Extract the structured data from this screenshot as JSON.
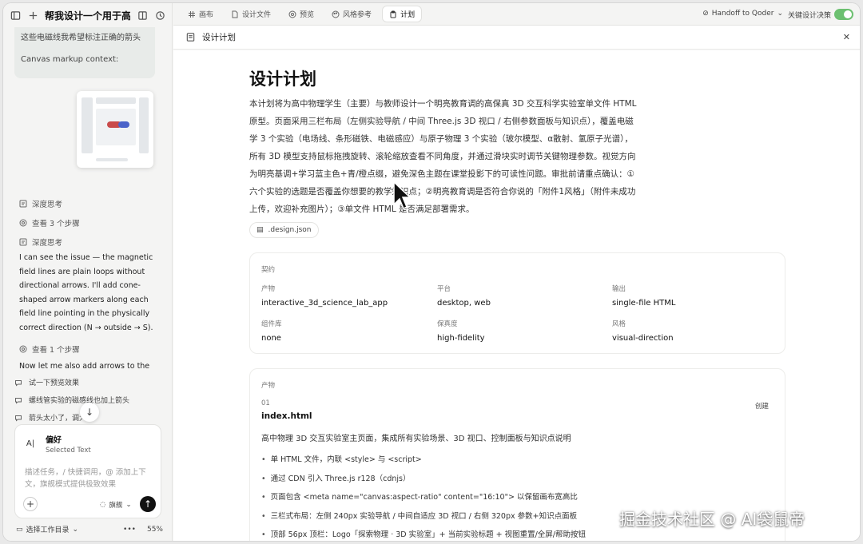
{
  "conversation": {
    "title": "帮我设计一个用于高中...",
    "context_card": {
      "line1": "这些电磁线我希望标注正确的箭头",
      "line2": "Canvas markup context:"
    }
  },
  "steps": [
    {
      "label": "深度思考"
    },
    {
      "label": "查看 3 个步骤"
    },
    {
      "label": "深度思考"
    },
    {
      "label": "查看 1 个步骤"
    }
  ],
  "messages": {
    "main": "I can see the issue — the magnetic field lines are plain loops without directional arrows. I'll add cone-shaped arrow markers along each field line pointing in the physically correct direction (N → outside → S).",
    "followup": "Now let me also add arrows to the"
  },
  "suggestions": [
    {
      "label": "试一下预览效果"
    },
    {
      "label": "螺线管实验的磁感线也加上箭头"
    },
    {
      "label": "箭头太小了，调大"
    }
  ],
  "composer": {
    "pref_title": "偏好",
    "pref_subtitle": "Selected Text",
    "placeholder": "描述任务，/ 快捷调用，@ 添加上下文，旗舰模式提供极致效果",
    "mode": "旗舰"
  },
  "footer": {
    "workspace": "选择工作目录",
    "dots": "•••",
    "percent": "55%"
  },
  "tabs": [
    {
      "label": "画布",
      "icon": "hash-icon"
    },
    {
      "label": "设计文件",
      "icon": "file-icon"
    },
    {
      "label": "预览",
      "icon": "eye-icon"
    },
    {
      "label": "风格参考",
      "icon": "palette-icon"
    },
    {
      "label": "计划",
      "icon": "clipboard-icon",
      "active": true
    }
  ],
  "topbar": {
    "handoff": "Handoff to Qoder",
    "toggle_label": "关键设计决策",
    "toggle_on": true
  },
  "doc": {
    "header_title": "设计计划",
    "title": "设计计划",
    "summary": "本计划将为高中物理学生（主要）与教师设计一个明亮教育调的高保真 3D 交互科学实验室单文件 HTML 原型。页面采用三栏布局（左侧实验导航 / 中间 Three.js 3D 视口 / 右侧参数面板与知识点），覆盖电磁学 3 个实验（电场线、条形磁铁、电磁感应）与原子物理 3 个实验（玻尔模型、α散射、氢原子光谱），所有 3D 模型支持鼠标拖拽旋转、滚轮缩放查看不同角度，并通过滑块实时调节关键物理参数。视觉方向为明亮基调+学习蓝主色+青/橙点缀，避免深色主题在课堂投影下的可读性问题。审批前请重点确认：①六个实验的选题是否覆盖你想要的教学知识点；②明亮教育调是否符合你说的「附件1风格」（附件未成功上传，欢迎补充图片）；③单文件 HTML 是否满足部署需求。",
    "file_chip": ".design.json"
  },
  "contract": {
    "label": "契约",
    "fields": [
      {
        "key": "产物",
        "value": "interactive_3d_science_lab_app"
      },
      {
        "key": "平台",
        "value": "desktop, web"
      },
      {
        "key": "输出",
        "value": "single-file HTML"
      },
      {
        "key": "组件库",
        "value": "none"
      },
      {
        "key": "保真度",
        "value": "high-fidelity"
      },
      {
        "key": "风格",
        "value": "visual-direction"
      }
    ]
  },
  "artifacts": {
    "label": "产物",
    "number": "01",
    "file": "index.html",
    "action": "创建",
    "description": "高中物理 3D 交互实验室主页面，集成所有实验场景、3D 视口、控制面板与知识点说明",
    "bullets": [
      "单 HTML 文件，内联 <style> 与 <script>",
      "通过 CDN 引入 Three.js r128（cdnjs）",
      "页面包含 <meta name=\"canvas:aspect-ratio\" content=\"16:10\"> 以保留画布宽高比",
      "三栏式布局：左侧 240px 实验导航 / 中间自适应 3D 视口 / 右侧 320px 参数+知识点面板",
      "顶部 56px 顶栏：Logo「探索物理 · 3D 实验室」+ 当前实验标题 + 视图重置/全屏/帮助按钮"
    ]
  },
  "watermark": "掘金技术社区 @ AI袋鼠帝"
}
